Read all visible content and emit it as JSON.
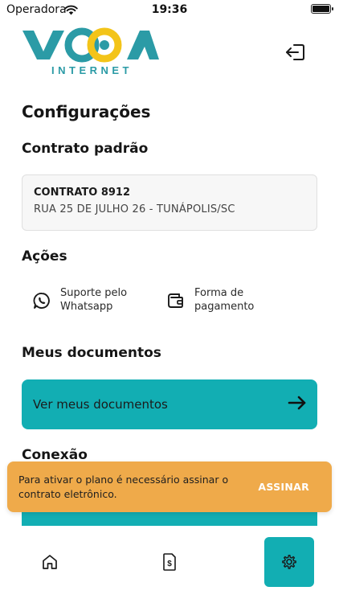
{
  "status_bar": {
    "carrier": "Operadora",
    "time": "19:36",
    "battery_level": 0.9
  },
  "header": {
    "logo_text": "VOOA",
    "logo_subtitle": "INTERNET",
    "logout_icon": "logout-icon"
  },
  "page": {
    "title": "Configurações"
  },
  "contract": {
    "section_title": "Contrato padrão",
    "name": "CONTRATO 8912",
    "address": "RUA 25 DE JULHO 26 - TUNÁPOLIS/SC"
  },
  "actions": {
    "section_title": "Ações",
    "items": [
      {
        "label": "Suporte pelo\nWhatsapp",
        "icon": "whatsapp-icon"
      },
      {
        "label": "Forma de\npagamento",
        "icon": "wallet-icon"
      }
    ]
  },
  "documents": {
    "section_title": "Meus documentos",
    "button_label": "Ver meus documentos",
    "button_icon": "arrow-right-icon"
  },
  "connection": {
    "section_title": "Conexão"
  },
  "toast": {
    "message": "Para ativar o plano é necessário assinar o contrato eletrônico.",
    "action_label": "ASSINAR"
  },
  "tabbar": {
    "items": [
      {
        "icon": "home-icon",
        "active": false
      },
      {
        "icon": "invoice-icon",
        "active": false
      },
      {
        "icon": "gear-icon",
        "active": true
      }
    ]
  },
  "colors": {
    "accent": "#12aeb3",
    "logo_teal": "#2b9ba6",
    "logo_yellow": "#f3c419",
    "toast": "#efaa4a"
  }
}
